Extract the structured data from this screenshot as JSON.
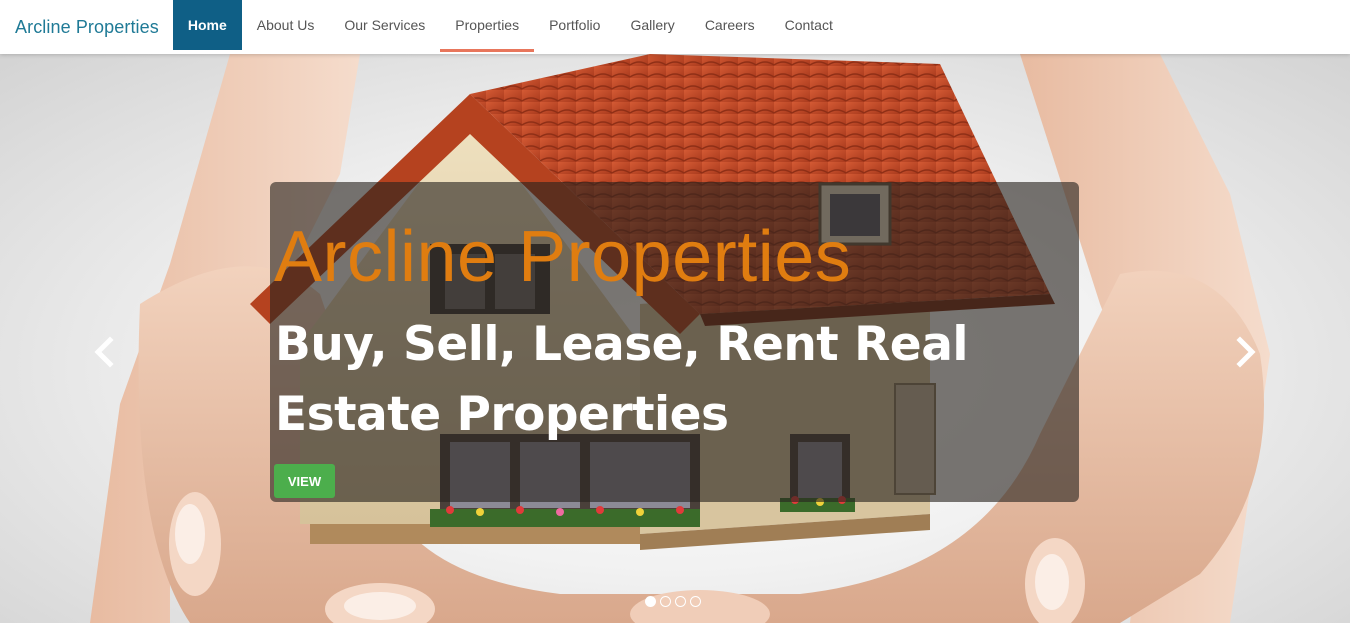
{
  "brand": "Arcline Properties",
  "nav": {
    "items": [
      {
        "label": "Home",
        "active": true
      },
      {
        "label": "About Us"
      },
      {
        "label": "Our Services"
      },
      {
        "label": "Properties",
        "hovered": true
      },
      {
        "label": "Portfolio"
      },
      {
        "label": "Gallery"
      },
      {
        "label": "Careers"
      },
      {
        "label": "Contact"
      }
    ]
  },
  "hero": {
    "title": "Arcline Properties",
    "subtitle": "Buy, Sell, Lease, Rent Real Estate Properties",
    "button_label": "VIEW",
    "prev_icon": "chevron-left-icon",
    "next_icon": "chevron-right-icon",
    "slides_count": 4,
    "active_slide": 1
  },
  "colors": {
    "brand": "#1f7a96",
    "nav_active": "#0f5f86",
    "nav_hover_underline": "#e8765c",
    "title_orange": "#e07d10",
    "button_green": "#4cae4c"
  }
}
